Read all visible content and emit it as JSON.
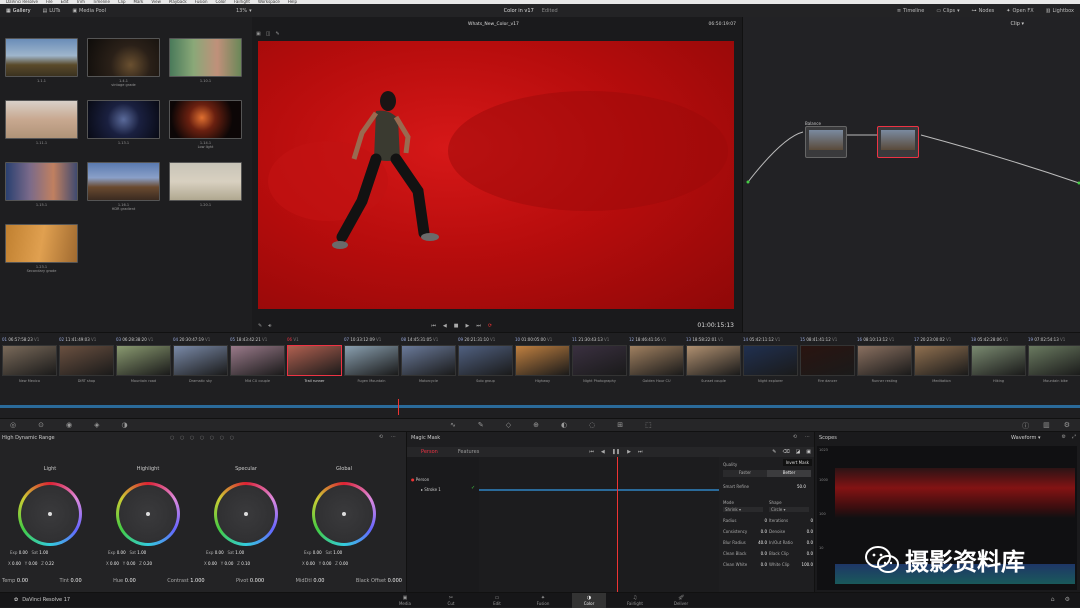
{
  "menubar": {
    "items": [
      "DaVinci Resolve",
      "File",
      "Edit",
      "Trim",
      "Timeline",
      "Clip",
      "Mark",
      "View",
      "Playback",
      "Fusion",
      "Color",
      "Fairlight",
      "Workspace",
      "Help"
    ]
  },
  "topbar": {
    "left": [
      "Gallery",
      "LUTs",
      "Media Pool"
    ],
    "zoom": "13%",
    "title": "Color in v17",
    "title_status": "Edited",
    "right": [
      "Timeline",
      "Clips",
      "Nodes",
      "Open FX",
      "Lightbox"
    ]
  },
  "gallery": {
    "thumbs": [
      {
        "label": "1.1.1",
        "sub": ""
      },
      {
        "label": "1.4.1",
        "sub": "vintage grade"
      },
      {
        "label": "1.10.1",
        "sub": ""
      },
      {
        "label": "1.11.1",
        "sub": ""
      },
      {
        "label": "1.13.1",
        "sub": ""
      },
      {
        "label": "1.14.1",
        "sub": "Low light"
      },
      {
        "label": "1.15.1",
        "sub": ""
      },
      {
        "label": "1.16.1",
        "sub": "HDR gradient"
      },
      {
        "label": "1.20.1",
        "sub": ""
      },
      {
        "label": "1.23.1",
        "sub": "Secondary grade"
      }
    ]
  },
  "viewer": {
    "clip_name": "Whats_New_Color_v17",
    "timecode_top": "06:50:19:07",
    "timecode_bottom": "01:00:15:13"
  },
  "nodes": {
    "node1_label": "Balance",
    "header": "Clip"
  },
  "timeline": {
    "clips": [
      {
        "num": "01",
        "tc": "06:57:58:23",
        "track": "V1",
        "name": "New Mexico"
      },
      {
        "num": "02",
        "tc": "11:41:49:03",
        "track": "V1",
        "name": "DIRT shop"
      },
      {
        "num": "03",
        "tc": "06:28:38:20",
        "track": "V1",
        "name": "Mountain road"
      },
      {
        "num": "04",
        "tc": "20:30:47:19",
        "track": "V1",
        "name": "Dramatic sky"
      },
      {
        "num": "05",
        "tc": "18:43:42:21",
        "track": "V1",
        "name": "Mid CU couple"
      },
      {
        "num": "06",
        "tc": "",
        "track": "V1",
        "name": "Trail runner"
      },
      {
        "num": "07",
        "tc": "10:33:12:09",
        "track": "V1",
        "name": "Fugen Mountain"
      },
      {
        "num": "08",
        "tc": "14:45:31:05",
        "track": "V1",
        "name": "Motorcycle"
      },
      {
        "num": "09",
        "tc": "20:21:31:10",
        "track": "V1",
        "name": "Solo group"
      },
      {
        "num": "10",
        "tc": "01:00:05:00",
        "track": "V1",
        "name": "Highway"
      },
      {
        "num": "11",
        "tc": "21:30:43:13",
        "track": "V1",
        "name": "Night Photography"
      },
      {
        "num": "12",
        "tc": "18:46:41:16",
        "track": "V1",
        "name": "Golden Hour CU"
      },
      {
        "num": "13",
        "tc": "18:58:22:01",
        "track": "V1",
        "name": "Sunset couple"
      },
      {
        "num": "14",
        "tc": "05:42:11:12",
        "track": "V1",
        "name": "Night explorer"
      },
      {
        "num": "15",
        "tc": "08:41:41:12",
        "track": "V1",
        "name": "Fire dancer"
      },
      {
        "num": "16",
        "tc": "08:10:13:12",
        "track": "V1",
        "name": "Runner resting"
      },
      {
        "num": "17",
        "tc": "20:23:00:02",
        "track": "V1",
        "name": "Meditation"
      },
      {
        "num": "18",
        "tc": "05:42:28:06",
        "track": "V1",
        "name": "Hiking"
      },
      {
        "num": "19",
        "tc": "07:02:54:13",
        "track": "V1",
        "name": "Mountain bike"
      }
    ]
  },
  "hdr": {
    "title": "High Dynamic Range",
    "wheels": [
      {
        "label": "Light",
        "exp": "0.00",
        "sat": "1.00",
        "x": "0.00",
        "y": "0.00",
        "z": "0.22"
      },
      {
        "label": "Highlight",
        "exp": "0.00",
        "sat": "1.00",
        "x": "0.00",
        "y": "0.00",
        "z": "0.20"
      },
      {
        "label": "Specular",
        "exp": "0.00",
        "sat": "1.00",
        "x": "0.00",
        "y": "0.00",
        "z": "0.10"
      },
      {
        "label": "Global",
        "exp": "0.00",
        "sat": "1.00",
        "x": "0.00",
        "y": "0.00",
        "z": "0.00"
      }
    ],
    "bottom": [
      {
        "label": "Temp",
        "value": "0.00"
      },
      {
        "label": "Tint",
        "value": "0.00"
      },
      {
        "label": "Hue",
        "value": "0.00"
      },
      {
        "label": "Contrast",
        "value": "1.000"
      },
      {
        "label": "Pivot",
        "value": "0.000"
      },
      {
        "label": "MidDtl",
        "value": "0.00"
      },
      {
        "label": "Black Offset",
        "value": "0.000"
      }
    ]
  },
  "magicmask": {
    "title": "Magic Mask",
    "tab_person": "Person",
    "tab_features": "Features",
    "track_person": "Person",
    "track_stroke": "Stroke 1",
    "tooltip": "Invert Mask",
    "quality_label": "Quality",
    "quality_opts": [
      "Faster",
      "Better"
    ],
    "smart_refine_label": "Smart Refine",
    "smart_refine_value": "50.0",
    "mode_label": "Mode",
    "mode_value": "Shrink",
    "shape_label": "Shape",
    "shape_value": "Circle",
    "params": [
      {
        "label": "Radius",
        "value": "0"
      },
      {
        "label": "Iterations",
        "value": "0"
      },
      {
        "label": "Consistency",
        "value": "0.0"
      },
      {
        "label": "Denoise",
        "value": "0.0"
      },
      {
        "label": "Blur Radius",
        "value": "40.0"
      },
      {
        "label": "In/Out Ratio",
        "value": "0.0"
      },
      {
        "label": "Clean Black",
        "value": "0.0"
      },
      {
        "label": "Black Clip",
        "value": "0.0"
      },
      {
        "label": "Clean White",
        "value": "0.0"
      },
      {
        "label": "White Clip",
        "value": "100.0"
      }
    ]
  },
  "scopes": {
    "title": "Scopes",
    "mode": "Waveform",
    "scale": [
      "1023",
      "1000",
      "100",
      "10"
    ]
  },
  "bottombar": {
    "app": "DaVinci Resolve 17",
    "pages": [
      "Media",
      "Cut",
      "Edit",
      "Fusion",
      "Color",
      "Fairlight",
      "Deliver"
    ]
  },
  "watermark": "摄影资料库"
}
